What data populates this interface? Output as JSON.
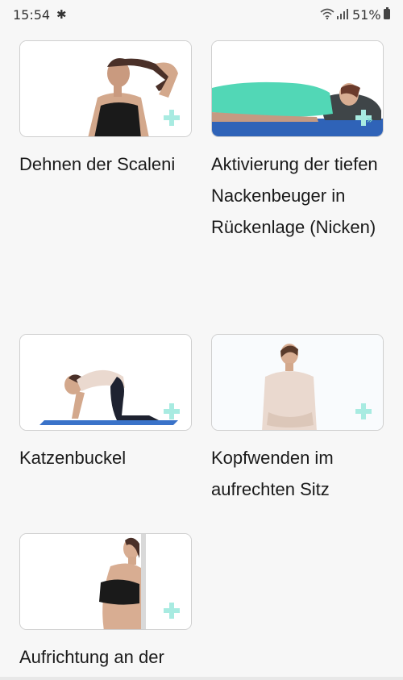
{
  "status_bar": {
    "time": "15:54",
    "battery_percent": "51%",
    "icons": [
      "bluetooth-icon",
      "wifi-icon",
      "signal-icon",
      "battery-icon"
    ]
  },
  "exercises": [
    {
      "title": "Dehnen der Scaleni",
      "thumbnail": "woman-neck-stretch",
      "badge": "plus-icon"
    },
    {
      "title": "Aktivierung der tiefen Nackenbeuger in Rückenlage (Nicken)",
      "thumbnail": "woman-lying-on-mat",
      "badge": "plus-icon"
    },
    {
      "title": "Katzenbuckel",
      "thumbnail": "woman-cat-pose",
      "badge": "plus-icon"
    },
    {
      "title": "Kopfwenden im aufrechten Sitz",
      "thumbnail": "woman-seated-head-turn",
      "badge": "plus-icon"
    },
    {
      "title": "Aufrichtung an der",
      "thumbnail": "woman-standing-wall",
      "badge": "plus-icon"
    }
  ],
  "colors": {
    "accent": "#a8ebe1",
    "mat": "#2f63b8",
    "shirt_green": "#52d7b6"
  }
}
